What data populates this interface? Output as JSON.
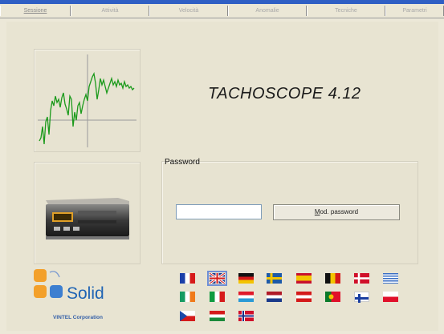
{
  "tabs": [
    {
      "label": "Sessione",
      "active": true
    },
    {
      "label": "Attività",
      "active": false
    },
    {
      "label": "Velocità",
      "active": false
    },
    {
      "label": "Anomalie",
      "active": false
    },
    {
      "label": "Tecniche",
      "active": false
    },
    {
      "label": "Parametri",
      "active": false
    }
  ],
  "app": {
    "title": "TACHOSCOPE 4.12"
  },
  "password": {
    "label": "Password",
    "value": "",
    "button_prefix": "",
    "button_accel": "M",
    "button_rest": "od. password"
  },
  "logo": {
    "brand": "Solid",
    "corp": "VINTEL Corporation"
  },
  "flags_row1": [
    "france-flag",
    "uk-flag",
    "germany-flag",
    "sweden-flag",
    "spain-flag",
    "belgium-flag",
    "denmark-flag",
    "greece-flag"
  ],
  "flags_row2": [
    "ireland-flag",
    "italy-flag",
    "luxembourg-flag",
    "netherlands-flag",
    "austria-flag",
    "portugal-flag",
    "finland-flag",
    "poland-flag"
  ],
  "flags_row3": [
    "czech-flag",
    "hungary-flag",
    "norway-flag"
  ],
  "colors": {
    "accent": "#2f5fc4",
    "brand": "#1f64b4",
    "chart_line": "#1b9a1b"
  }
}
